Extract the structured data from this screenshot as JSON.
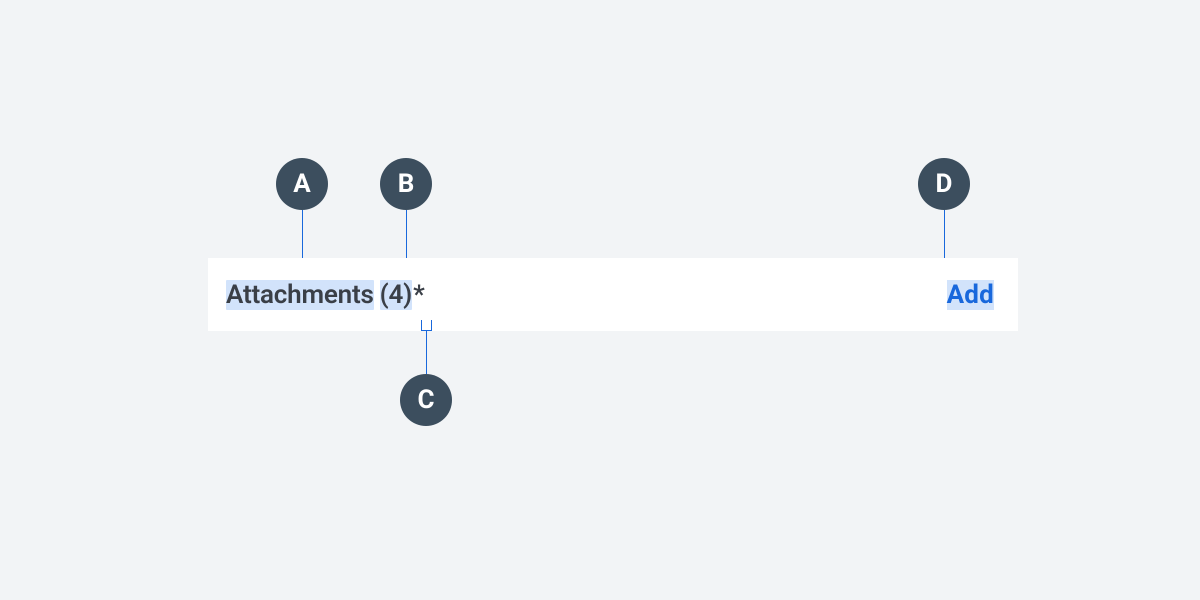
{
  "labels": {
    "a": "A",
    "b": "B",
    "c": "C",
    "d": "D"
  },
  "panel": {
    "title": "Attachments",
    "count": "(4)",
    "indicator": "*",
    "action": "Add"
  },
  "colors": {
    "circle": "#3c4e5e",
    "connector": "#1968dc",
    "link": "#1968dc",
    "highlight": "#d2e3fb",
    "panel_bg": "#ffffff",
    "page_bg": "#f2f4f6"
  }
}
